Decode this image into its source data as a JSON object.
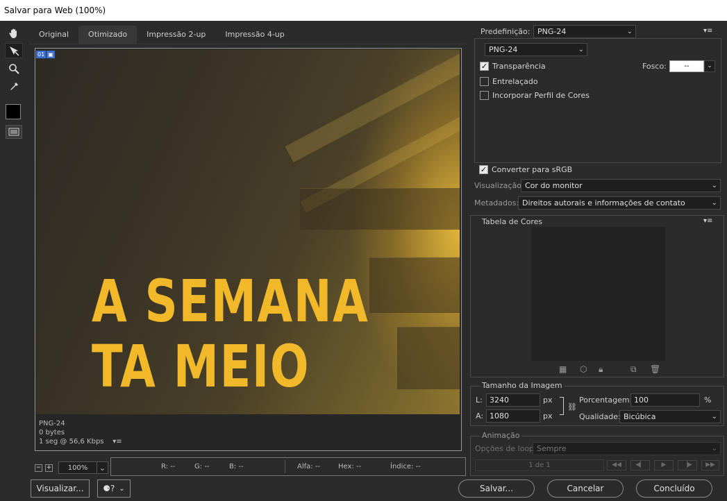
{
  "window": {
    "title": "Salvar para Web (100%)"
  },
  "tools": [
    {
      "name": "hand-icon"
    },
    {
      "name": "slice-select-icon"
    },
    {
      "name": "zoom-icon"
    },
    {
      "name": "eyedropper-icon"
    },
    {
      "name": "eyedropper-color-swatch"
    },
    {
      "name": "toggle-slices-icon"
    }
  ],
  "tabs": [
    {
      "label": "Original"
    },
    {
      "label": "Otimizado"
    },
    {
      "label": "Impressão 2-up"
    },
    {
      "label": "Impressão 4-up"
    }
  ],
  "canvas": {
    "slice_number": "01",
    "headline_line1": "A SEMANA",
    "headline_line2": "TA MEIO",
    "info_format": "PNG-24",
    "info_size": "0 bytes",
    "info_time": "1 seg @ 56,6 Kbps",
    "info_menu": "▾≡"
  },
  "zoom": {
    "minus": "−",
    "plus": "+",
    "value": "100%"
  },
  "readout": {
    "r": "R: --",
    "g": "G: --",
    "b": "B: --",
    "alpha": "Alfa: --",
    "hex": "Hex: --",
    "index": "Índice: --"
  },
  "buttons": {
    "preview": "Visualizar...",
    "save": "Salvar...",
    "cancel": "Cancelar",
    "done": "Concluído"
  },
  "settings": {
    "preset_label": "Predefinição:",
    "preset_value": "PNG-24",
    "format_value": "PNG-24",
    "transparency": "Transparência",
    "transparency_checked": true,
    "interlaced": "Entrelaçado",
    "embed_profile": "Incorporar Perfil de Cores",
    "matte_label": "Fosco:",
    "matte_value": "--",
    "convert_srgb": "Converter para sRGB",
    "convert_srgb_checked": true,
    "preview_label": "Visualização:",
    "preview_value": "Cor do monitor",
    "metadata_label": "Metadados:",
    "metadata_value": "Direitos autorais e informações de contato"
  },
  "color_table": {
    "title": "Tabela de Cores"
  },
  "image_size": {
    "title": "Tamanho da Imagem",
    "width_label": "L:",
    "width_value": "3240",
    "height_label": "A:",
    "height_value": "1080",
    "unit": "px",
    "percent_label": "Porcentagem:",
    "percent_value": "100",
    "percent_unit": "%",
    "quality_label": "Qualidade:",
    "quality_value": "Bicúbica"
  },
  "animation": {
    "title": "Animação",
    "loop_label": "Opções de loop:",
    "loop_value": "Sempre",
    "frame_counter": "1 de 1"
  },
  "colors": {
    "accent": "#f1b92a",
    "slice_blue": "#3a6fd0"
  }
}
